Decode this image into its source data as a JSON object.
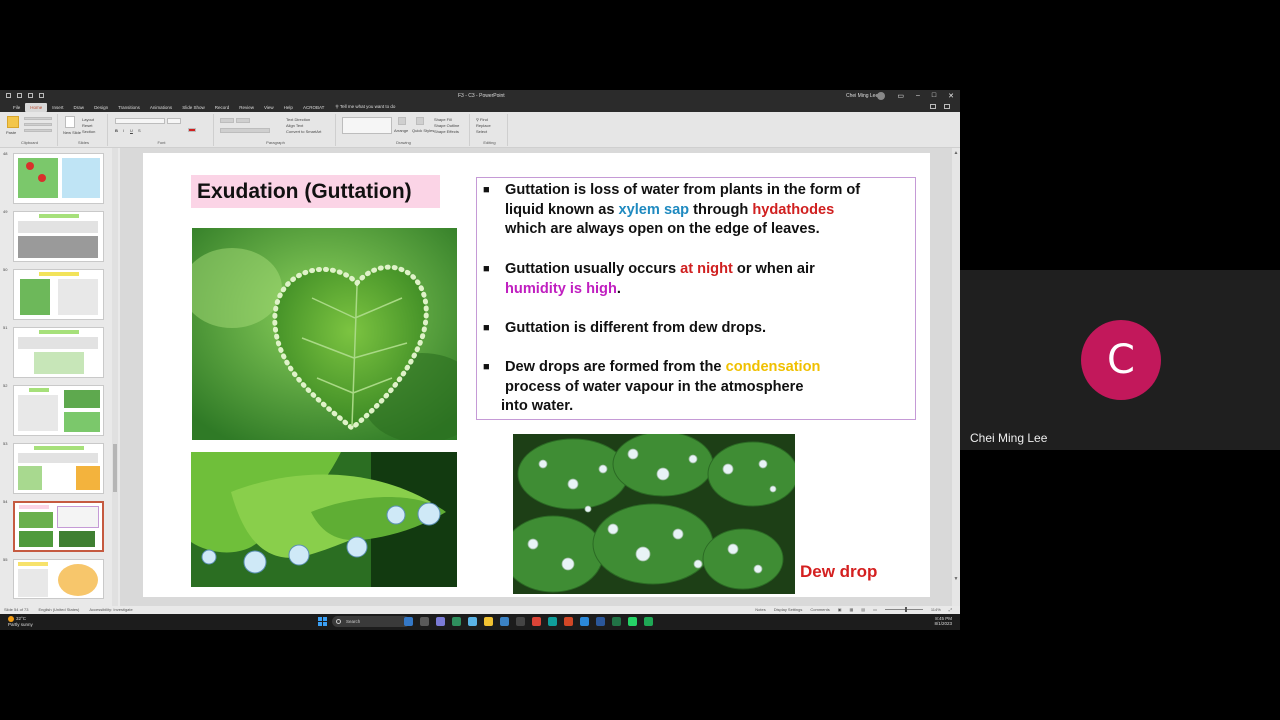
{
  "window": {
    "doc_title": "F3 - C3",
    "app_name": "PowerPoint",
    "user_name": "Chei Ming Lee"
  },
  "menu": {
    "tabs": [
      "File",
      "Home",
      "Insert",
      "Draw",
      "Design",
      "Transitions",
      "Animations",
      "Slide Show",
      "Record",
      "Review",
      "View",
      "Help",
      "ACROBAT"
    ],
    "active_tab": "Home",
    "tell_me": "Tell me what you want to do"
  },
  "ribbon": {
    "groups": [
      "Clipboard",
      "Slides",
      "Font",
      "Paragraph",
      "Drawing",
      "Editing"
    ],
    "paste": "Paste",
    "new_slide": "New Slide",
    "layout": "Layout",
    "reset": "Reset",
    "section": "Section",
    "text_direction": "Text Direction",
    "align_text": "Align Text",
    "convert_smartart": "Convert to SmartArt",
    "arrange": "Arrange",
    "quick_styles": "Quick Styles",
    "shape_fill": "Shape Fill",
    "shape_outline": "Shape Outline",
    "shape_effects": "Shape Effects",
    "find": "Find",
    "replace": "Replace",
    "select": "Select"
  },
  "thumbnails": {
    "numbers": [
      "48",
      "49",
      "50",
      "51",
      "52",
      "53",
      "54",
      "55"
    ],
    "selected_index": 6
  },
  "slide": {
    "title": "Exudation (Guttation)",
    "bullets": {
      "b1": {
        "l1": "Guttation is loss of water from plants in the form of",
        "l2a": "liquid known as ",
        "l2b": "xylem sap",
        "l2c": " through ",
        "l2d": "hydathodes",
        "l3": "which are always open on the edge of leaves."
      },
      "b2": {
        "l1a": "Guttation usually occurs ",
        "l1b": "at night",
        "l1c": " or when air",
        "l2a": "humidity is high",
        "l2b": "."
      },
      "b3": {
        "l1": "Guttation is different from dew drops."
      },
      "b4": {
        "l1a": "Dew drops are formed from the ",
        "l1b": "condensation",
        "l2": " process of water vapour in the atmosphere",
        "l3": "into water."
      }
    },
    "dew_label": "Dew drop"
  },
  "colors": {
    "xylem": "#1f8ac0",
    "red_highlight": "#d02020",
    "magenta_highlight": "#c01fc0",
    "yellow_highlight": "#f0c000",
    "title_bg": "#fbd4e6",
    "participant_avatar": "#c2185b"
  },
  "statusbar": {
    "slide_info": "Slide 54 of 73",
    "language": "English (United States)",
    "accessibility": "Accessibility: Investigate",
    "notes": "Notes",
    "display_settings": "Display Settings",
    "comments": "Comments",
    "zoom": "114%"
  },
  "taskbar": {
    "temperature": "32°C",
    "weather": "Partly sunny",
    "search": "Search",
    "time": "8:45 PM",
    "date": "8/1/2023"
  },
  "meeting": {
    "initial": "C",
    "participant_name": "Chei Ming Lee"
  }
}
